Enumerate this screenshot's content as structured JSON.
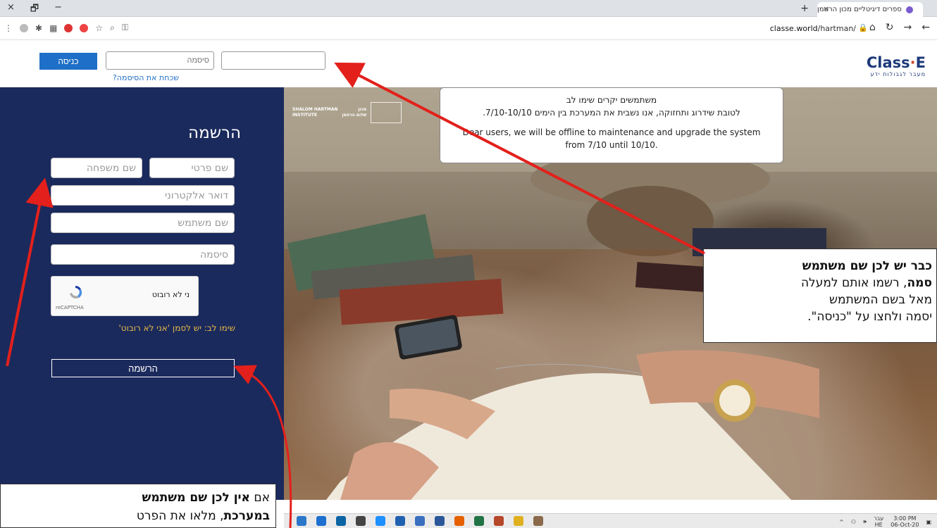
{
  "browser": {
    "tab_title": "ספרים דיגיטליים מכון הרטמן",
    "tab_close": "×",
    "new_tab": "+",
    "url_host": "classe.world",
    "url_path": "/hartman/",
    "win_close": "×",
    "win_restore": "🗗",
    "win_min": "−",
    "nav_back": "←",
    "nav_forward": "→",
    "nav_reload": "↻",
    "nav_home": "⌂"
  },
  "header": {
    "login_label": "כניסה",
    "password_placeholder": "סיסמה",
    "username_placeholder": "",
    "forgot_label": "שכחת את הסיסמה?",
    "logo_main": "Class",
    "logo_dot": "·",
    "logo_end": "E",
    "logo_tagline": "מעבר לגבולות ידע"
  },
  "registration": {
    "title": "הרשמה",
    "first_name": "שם פרטי",
    "last_name": "שם משפחה",
    "email": "דואר אלקטרוני",
    "username": "שם משתמש",
    "password": "סיסמה",
    "captcha_text": "ני לא רובוט",
    "captcha_brand": "reCAPTCHA",
    "note": "שימו לב: יש לסמן 'אני לא רובוט'",
    "submit_label": "הרשמה"
  },
  "notice": {
    "he_title": "משתמשים יקרים שימו לב",
    "he_body": "לטובת שידרוג ותחזוקה, אנו נשבית את המערכת  בין הימים 7/10-10/10.",
    "en_line1": "Dear users, we will be offline to maintenance and upgrade  the system",
    "en_line2": "from 7/10 until 10/10."
  },
  "hartman_logo": {
    "en1": "SHALOM HARTMAN",
    "en2": "INSTITUTE",
    "he1": "מכון",
    "he2": "שלום הרטמן"
  },
  "callout_right": {
    "line1_bold": "כבר יש לכן שם משתמש",
    "line2_bold": "סמה",
    "line2_rest": ", רשמו אותם למעלה",
    "line3": "מאל בשם המשתמש",
    "line4": "יסמה ולחצו על \"כניסה\"."
  },
  "callout_left": {
    "line1_pre": "אם ",
    "line1_bold": "אין לכן שם משתמש",
    "line2_bold": "במערכת",
    "line2_rest": ", מלאו את הפרט"
  },
  "taskbar": {
    "lang1": "עבר",
    "lang2": "HE",
    "time": "3:00 PM",
    "date": "06-Oct-20"
  },
  "colors": {
    "panel": "#1b2a5c",
    "login_button": "#1e6fc7",
    "note": "#e6b84a",
    "arrow": "#e3201b"
  }
}
